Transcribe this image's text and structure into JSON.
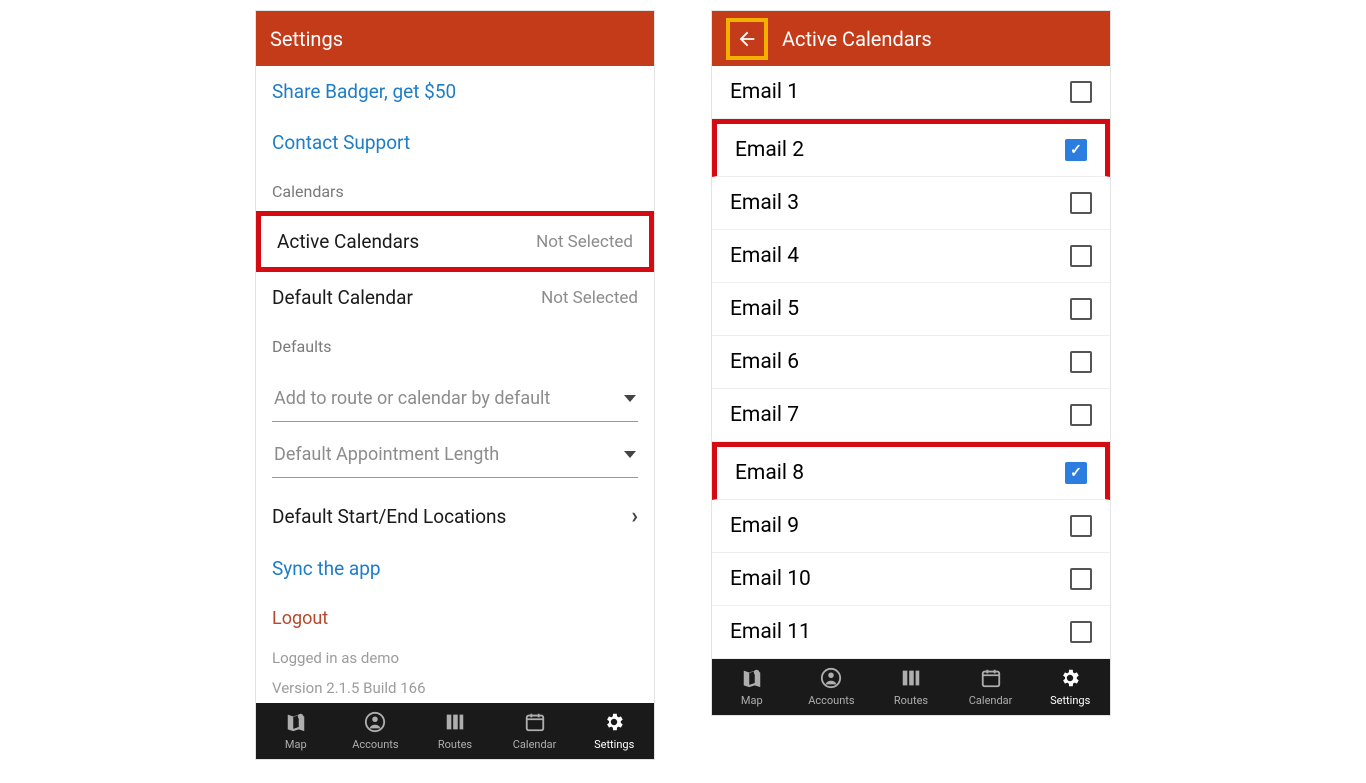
{
  "left": {
    "title": "Settings",
    "links": {
      "share": "Share Badger, get $50",
      "support": "Contact Support",
      "sync": "Sync the app"
    },
    "sections": {
      "calendars": "Calendars",
      "defaults": "Defaults"
    },
    "rows": {
      "active_calendars": {
        "label": "Active Calendars",
        "value": "Not Selected"
      },
      "default_calendar": {
        "label": "Default Calendar",
        "value": "Not Selected"
      },
      "default_locations": {
        "label": "Default Start/End Locations"
      }
    },
    "dropdowns": {
      "add_default": "Add to route or calendar by default",
      "appt_length": "Default Appointment Length"
    },
    "logout": "Logout",
    "meta": {
      "logged_in": "Logged in as demo",
      "version": "Version 2.1.5 Build 166"
    }
  },
  "right": {
    "title": "Active Calendars",
    "emails": [
      {
        "label": "Email 1",
        "checked": false,
        "highlight": false
      },
      {
        "label": "Email 2",
        "checked": true,
        "highlight": true
      },
      {
        "label": "Email 3",
        "checked": false,
        "highlight": false
      },
      {
        "label": "Email 4",
        "checked": false,
        "highlight": false
      },
      {
        "label": "Email 5",
        "checked": false,
        "highlight": false
      },
      {
        "label": "Email 6",
        "checked": false,
        "highlight": false
      },
      {
        "label": "Email 7",
        "checked": false,
        "highlight": false
      },
      {
        "label": "Email 8",
        "checked": true,
        "highlight": true
      },
      {
        "label": "Email 9",
        "checked": false,
        "highlight": false
      },
      {
        "label": "Email 10",
        "checked": false,
        "highlight": false
      },
      {
        "label": "Email 11",
        "checked": false,
        "highlight": false
      }
    ]
  },
  "nav": [
    {
      "id": "map",
      "label": "Map"
    },
    {
      "id": "accounts",
      "label": "Accounts"
    },
    {
      "id": "routes",
      "label": "Routes"
    },
    {
      "id": "calendar",
      "label": "Calendar"
    },
    {
      "id": "settings",
      "label": "Settings"
    }
  ]
}
